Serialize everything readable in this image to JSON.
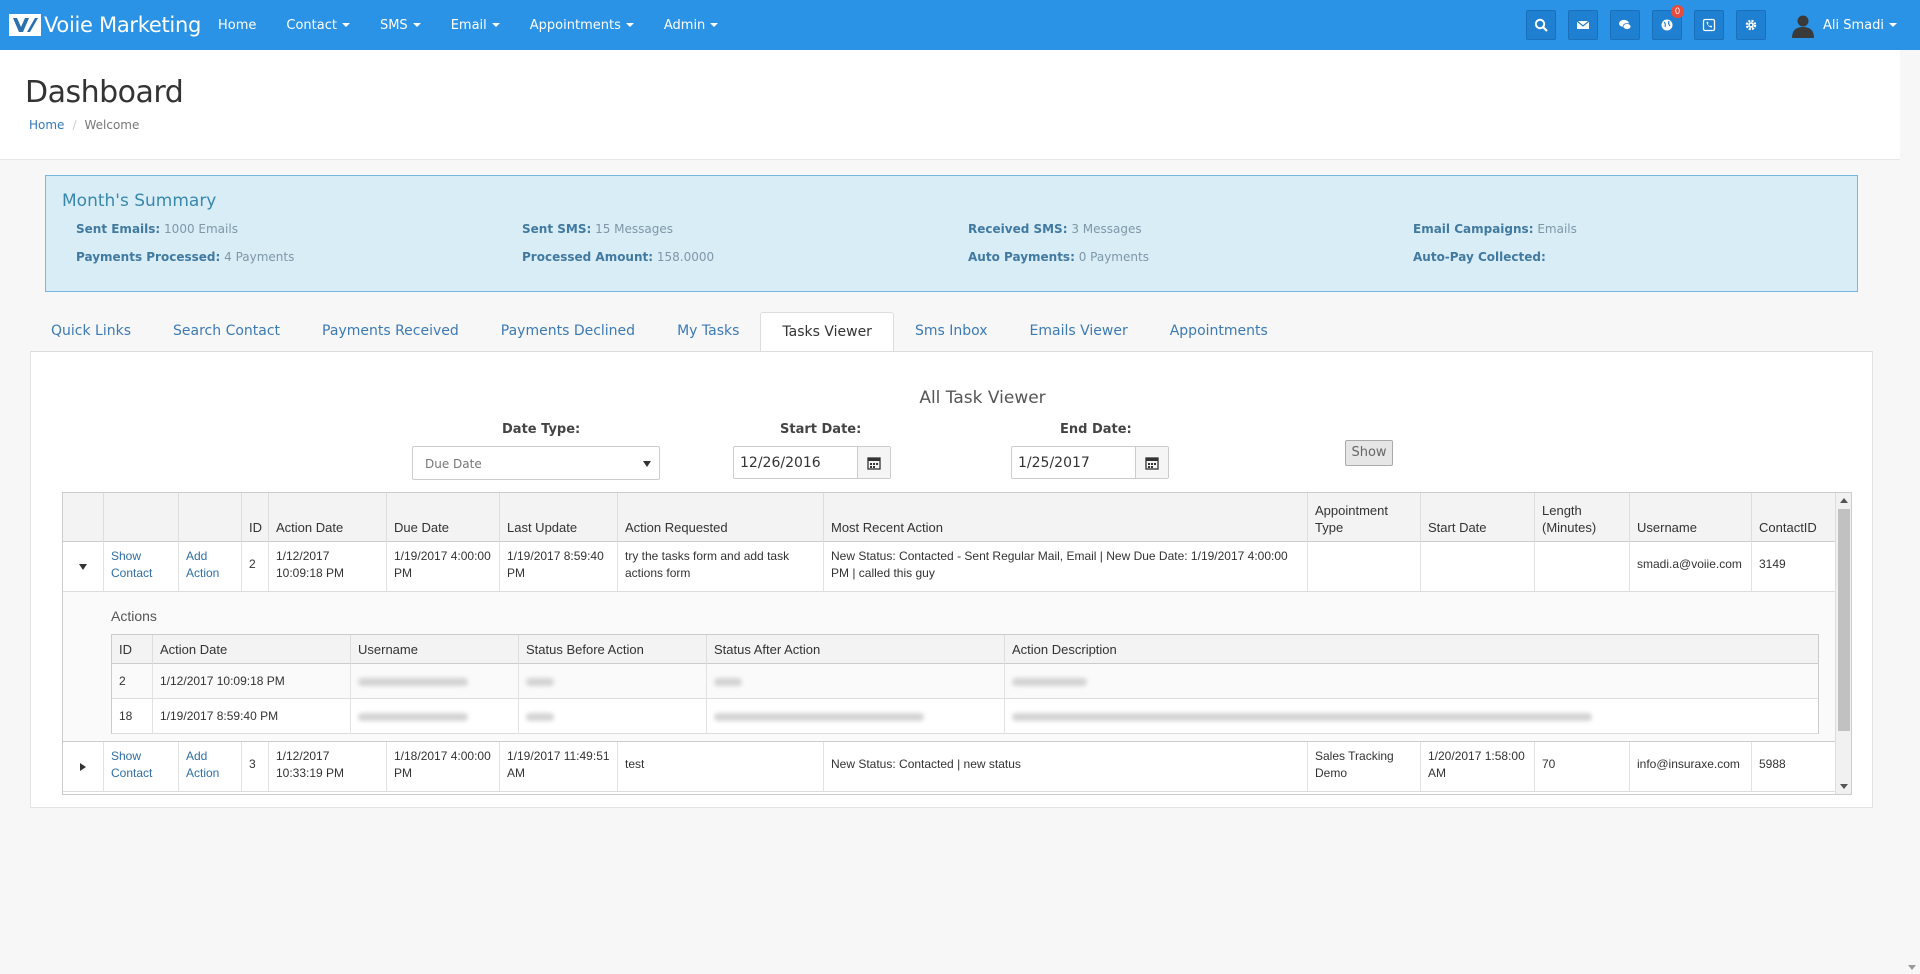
{
  "nav": {
    "brand": "Voiie Marketing",
    "menu": [
      {
        "label": "Home",
        "dropdown": false
      },
      {
        "label": "Contact",
        "dropdown": true
      },
      {
        "label": "SMS",
        "dropdown": true
      },
      {
        "label": "Email",
        "dropdown": true
      },
      {
        "label": "Appointments",
        "dropdown": true
      },
      {
        "label": "Admin",
        "dropdown": true
      }
    ],
    "notification_count": "0",
    "user_name": "Ali Smadi",
    "icons": [
      "search-icon",
      "envelope-icon",
      "chat-icon",
      "globe-icon",
      "phone-icon",
      "gear-icon"
    ]
  },
  "header": {
    "title": "Dashboard",
    "breadcrumb": [
      "Home",
      "Welcome"
    ]
  },
  "summary": {
    "title": "Month's Summary",
    "items": [
      {
        "label": "Sent Emails:",
        "value": "1000 Emails"
      },
      {
        "label": "Sent SMS:",
        "value": "15 Messages"
      },
      {
        "label": "Received SMS:",
        "value": "3 Messages"
      },
      {
        "label": "Email Campaigns:",
        "value": "Emails"
      },
      {
        "label": "Payments Processed:",
        "value": "4 Payments"
      },
      {
        "label": "Processed Amount:",
        "value": "158.0000"
      },
      {
        "label": "Auto Payments:",
        "value": "0 Payments"
      },
      {
        "label": "Auto-Pay Collected:",
        "value": ""
      }
    ]
  },
  "tabs": [
    "Quick Links",
    "Search Contact",
    "Payments Received",
    "Payments Declined",
    "My Tasks",
    "Tasks Viewer",
    "Sms Inbox",
    "Emails Viewer",
    "Appointments"
  ],
  "active_tab": "Tasks Viewer",
  "viewer": {
    "title": "All Task Viewer",
    "date_type_label": "Date Type:",
    "date_type_value": "Due Date",
    "start_date_label": "Start Date:",
    "start_date_value": "12/26/2016",
    "end_date_label": "End Date:",
    "end_date_value": "1/25/2017",
    "show_label": "Show"
  },
  "grid": {
    "headers": [
      "",
      "",
      "",
      "ID",
      "Action Date",
      "Due Date",
      "Last Update",
      "Action Requested",
      "Most Recent Action",
      "Appointment Type",
      "Start Date",
      "Length (Minutes)",
      "Username",
      "ContactID"
    ],
    "show_contact": "Show Contact",
    "add_action": "Add Action",
    "rows": [
      {
        "id": "2",
        "action_date": "1/12/2017 10:09:18 PM",
        "due_date": "1/19/2017 4:00:00 PM",
        "last_update": "1/19/2017 8:59:40 PM",
        "action_requested": "try the tasks form and add task actions form",
        "most_recent_action": "New Status: Contacted - Sent Regular Mail, Email | New Due Date: 1/19/2017 4:00:00 PM | called this guy",
        "appointment_type": "",
        "start_date": "",
        "length": "",
        "username": "smadi.a@voiie.com",
        "contact_id": "3149"
      },
      {
        "id": "3",
        "action_date": "1/12/2017 10:33:19 PM",
        "due_date": "1/18/2017 4:00:00 PM",
        "last_update": "1/19/2017 11:49:51 AM",
        "action_requested": "test",
        "most_recent_action": "New Status: Contacted | new status",
        "appointment_type": "Sales Tracking Demo",
        "start_date": "1/20/2017 1:58:00 AM",
        "length": "70",
        "username": "info@insuraxe.com",
        "contact_id": "5988"
      }
    ],
    "detail": {
      "title": "Actions",
      "headers": [
        "ID",
        "Action Date",
        "Username",
        "Status Before Action",
        "Status After Action",
        "Action Description"
      ],
      "rows": [
        {
          "id": "2",
          "action_date": "1/12/2017 10:09:18 PM"
        },
        {
          "id": "18",
          "action_date": "1/19/2017 8:59:40 PM"
        }
      ]
    }
  }
}
